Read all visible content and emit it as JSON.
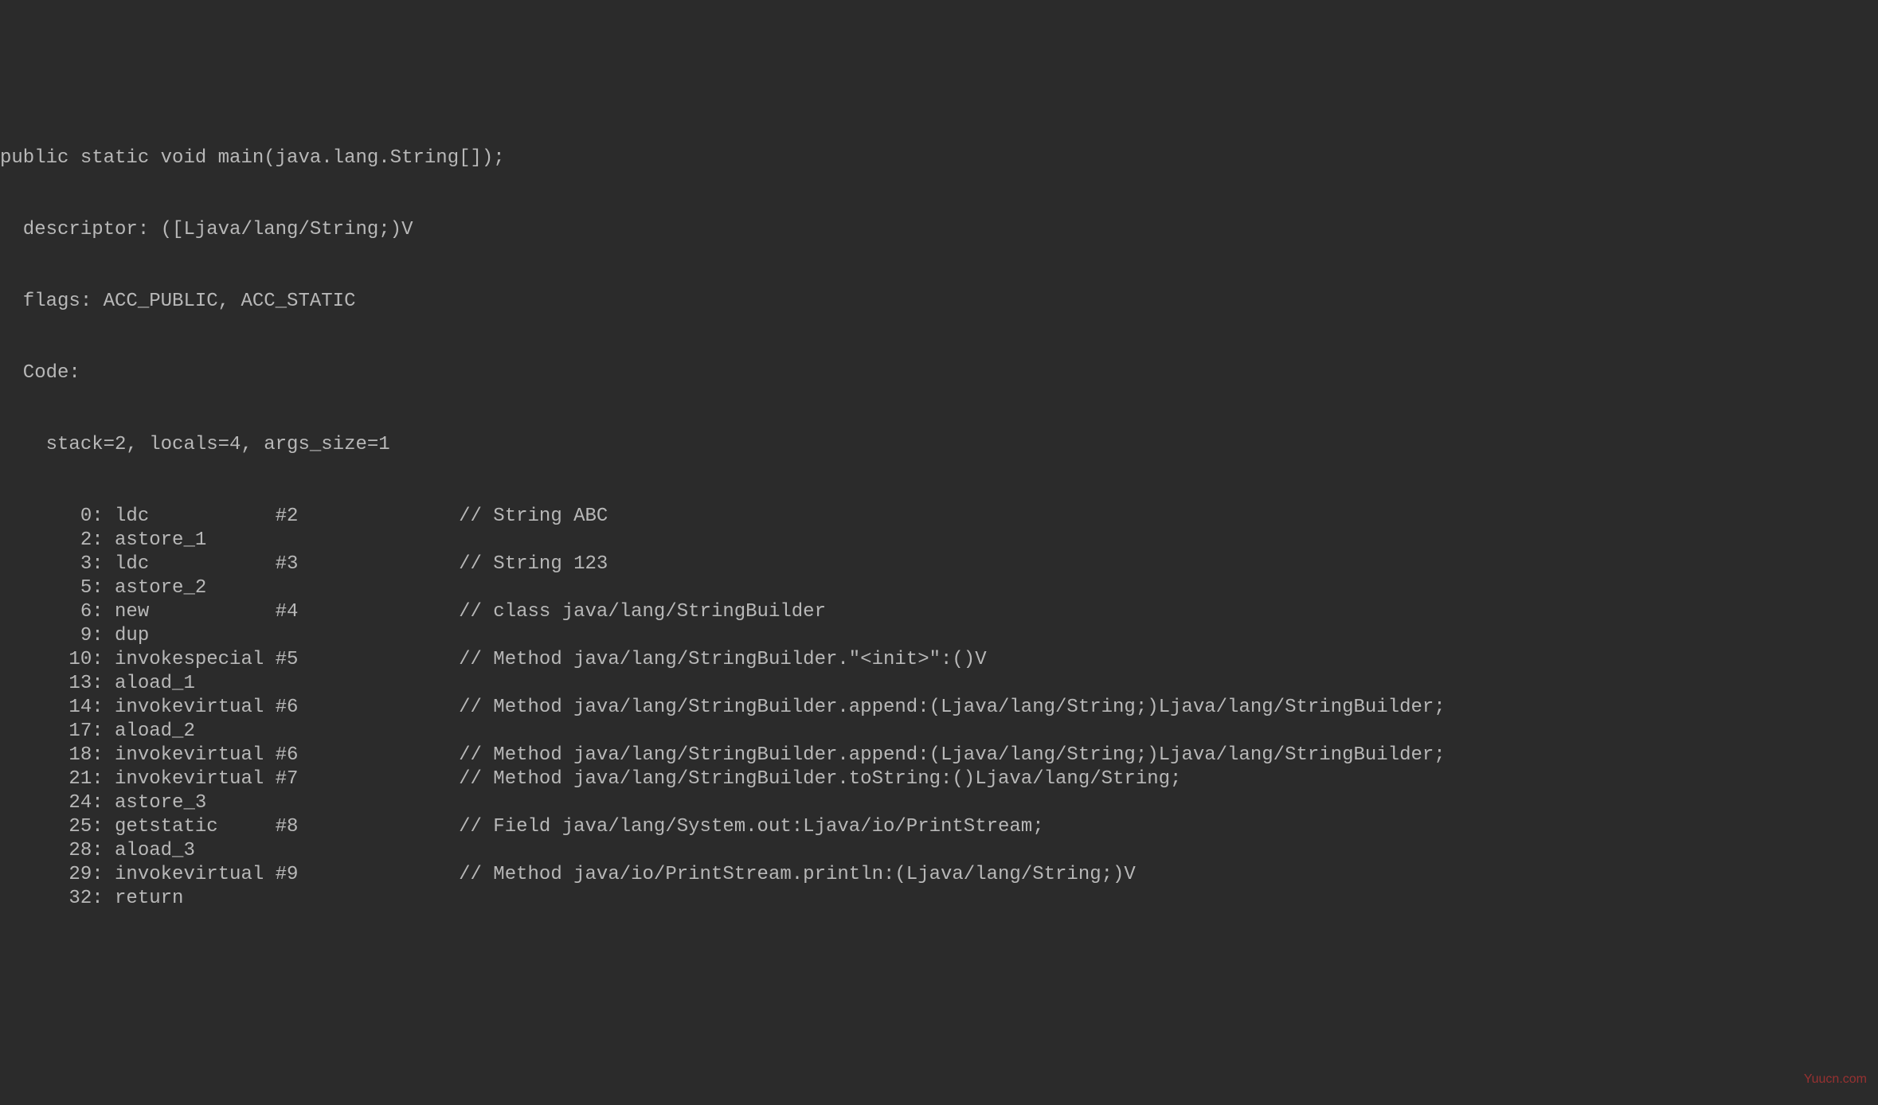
{
  "code": {
    "signature": "public static void main(java.lang.String[]);",
    "descriptor_label": "  descriptor: ([Ljava/lang/String;)V",
    "flags_label": "  flags: ACC_PUBLIC, ACC_STATIC",
    "code_label": "  Code:",
    "stack_label": "    stack=2, locals=4, args_size=1",
    "instructions": [
      {
        "offset": "       0:",
        "op": "ldc           #2",
        "comment": "// String ABC"
      },
      {
        "offset": "       2:",
        "op": "astore_1",
        "comment": ""
      },
      {
        "offset": "       3:",
        "op": "ldc           #3",
        "comment": "// String 123"
      },
      {
        "offset": "       5:",
        "op": "astore_2",
        "comment": ""
      },
      {
        "offset": "       6:",
        "op": "new           #4",
        "comment": "// class java/lang/StringBuilder"
      },
      {
        "offset": "       9:",
        "op": "dup",
        "comment": ""
      },
      {
        "offset": "      10:",
        "op": "invokespecial #5",
        "comment": "// Method java/lang/StringBuilder.\"<init>\":()V"
      },
      {
        "offset": "      13:",
        "op": "aload_1",
        "comment": ""
      },
      {
        "offset": "      14:",
        "op": "invokevirtual #6",
        "comment": "// Method java/lang/StringBuilder.append:(Ljava/lang/String;)Ljava/lang/StringBuilder;"
      },
      {
        "offset": "      17:",
        "op": "aload_2",
        "comment": ""
      },
      {
        "offset": "      18:",
        "op": "invokevirtual #6",
        "comment": "// Method java/lang/StringBuilder.append:(Ljava/lang/String;)Ljava/lang/StringBuilder;"
      },
      {
        "offset": "      21:",
        "op": "invokevirtual #7",
        "comment": "// Method java/lang/StringBuilder.toString:()Ljava/lang/String;"
      },
      {
        "offset": "      24:",
        "op": "astore_3",
        "comment": ""
      },
      {
        "offset": "      25:",
        "op": "getstatic     #8",
        "comment": "// Field java/lang/System.out:Ljava/io/PrintStream;"
      },
      {
        "offset": "      28:",
        "op": "aload_3",
        "comment": ""
      },
      {
        "offset": "      29:",
        "op": "invokevirtual #9",
        "comment": "// Method java/io/PrintStream.println:(Ljava/lang/String;)V"
      },
      {
        "offset": "      32:",
        "op": "return",
        "comment": ""
      }
    ]
  },
  "watermark": "Yuucn.com"
}
